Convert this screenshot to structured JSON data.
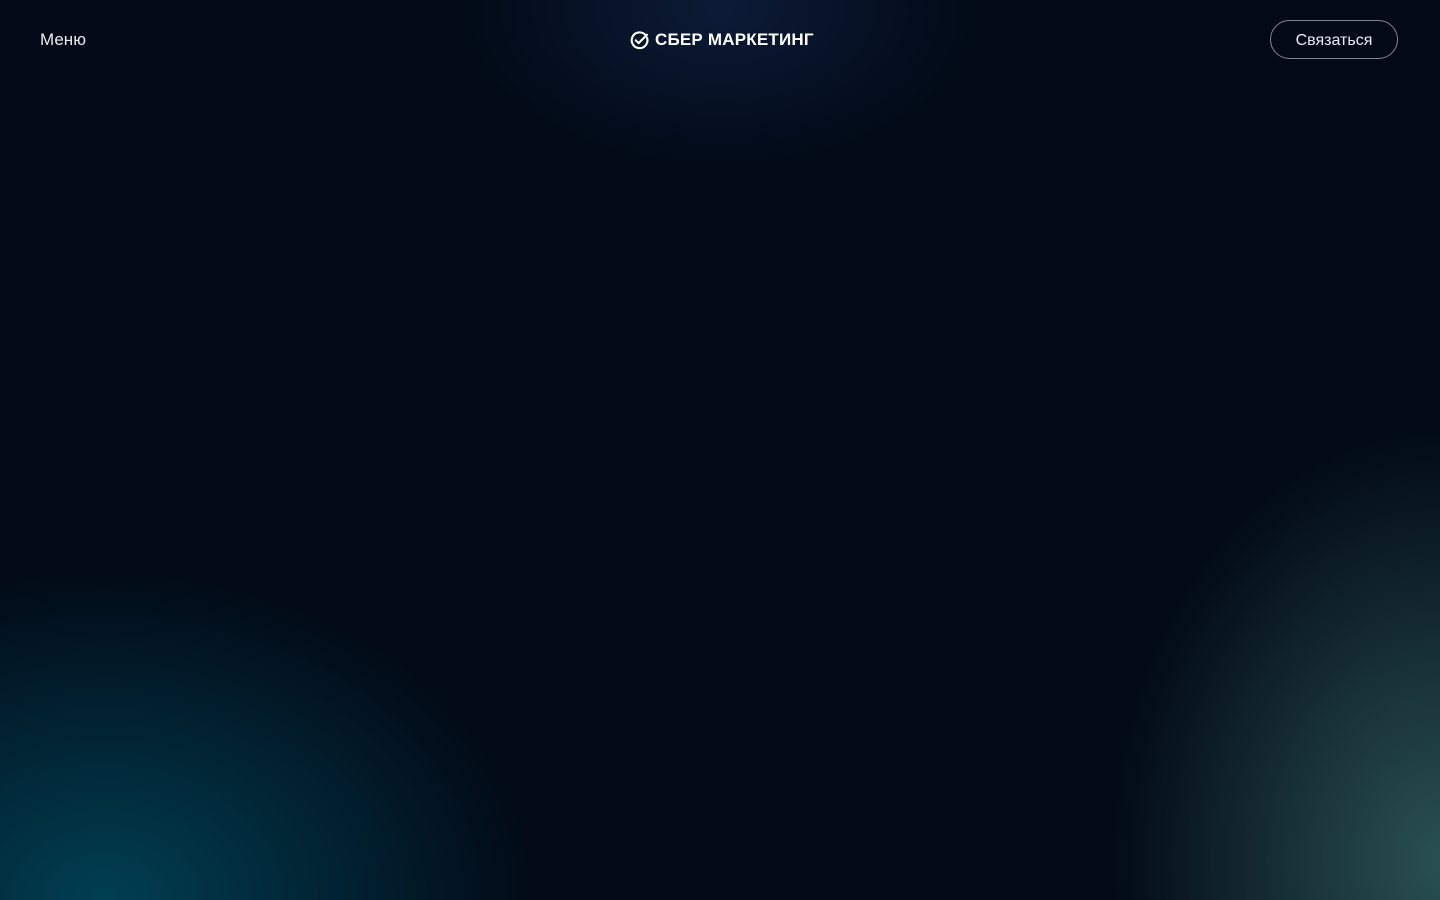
{
  "header": {
    "menu_label": "Меню",
    "logo_text": "СБЕР МАРКЕТИНГ",
    "logo_icon": "sber-check-icon",
    "contact_label": "Связаться"
  },
  "colors": {
    "background": "#020a17",
    "text": "#e8edf5",
    "glow_left": "#00485c",
    "glow_right": "#2e5858"
  }
}
